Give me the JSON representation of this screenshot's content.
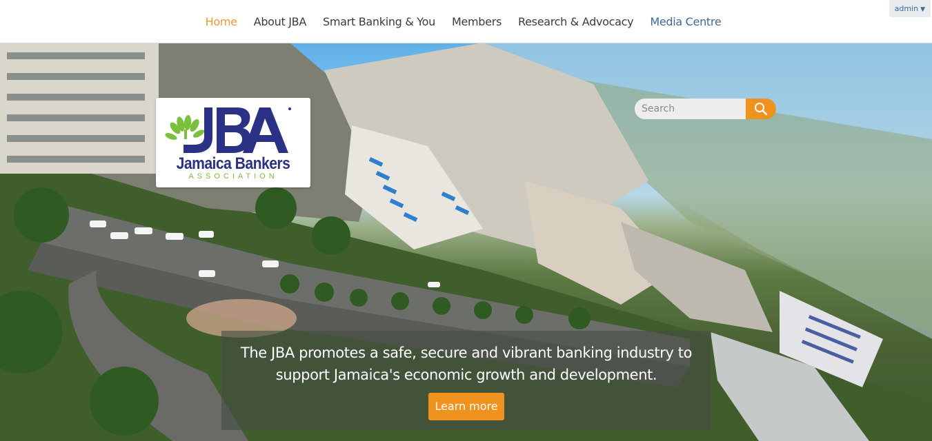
{
  "nav": {
    "items": [
      {
        "label": "Home",
        "active": true
      },
      {
        "label": "About JBA"
      },
      {
        "label": "Smart Banking & You"
      },
      {
        "label": "Members"
      },
      {
        "label": "Research & Advocacy"
      },
      {
        "label": "Media Centre"
      }
    ]
  },
  "admin": {
    "label": "admin",
    "caret": "▼"
  },
  "logo": {
    "mark": "JBA",
    "name": "Jamaica Bankers",
    "tagline": "ASSOCIATION",
    "icon": "leaf-tree-icon"
  },
  "search": {
    "placeholder": "Search",
    "icon": "search-icon"
  },
  "caption": {
    "text": "The JBA promotes a safe, secure and vibrant banking industry to support Jamaica's economic growth and development.",
    "button_label": "Learn more"
  },
  "colors": {
    "accent": "#f0921e",
    "nav_active": "#e99a3c",
    "nav_link": "#3b3b3b",
    "brand_blue": "#2b3184",
    "brand_green": "#7cbf3b"
  }
}
